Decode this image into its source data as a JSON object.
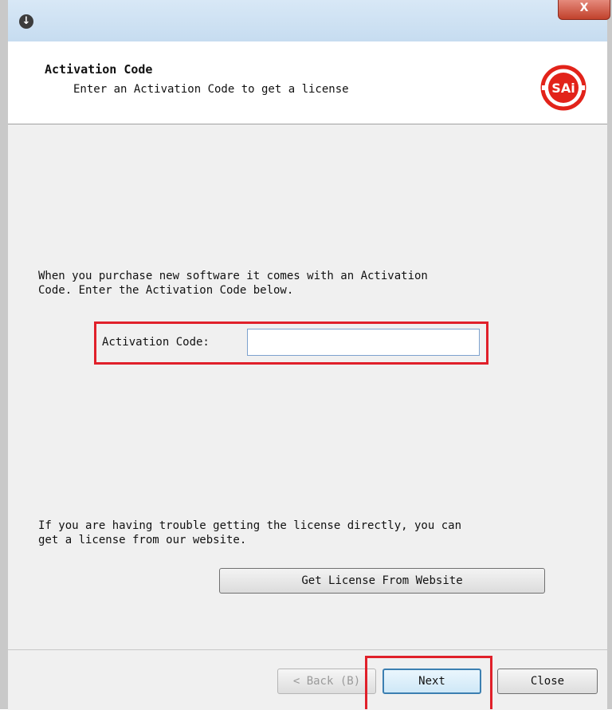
{
  "window": {
    "close_label": "X"
  },
  "header": {
    "title": "Activation Code",
    "subtitle": "Enter an Activation Code to get a license",
    "logo_text": "SAi",
    "logo_color": "#e2231a"
  },
  "main": {
    "intro_text": "When you purchase new software it comes with an Activation\nCode.  Enter the Activation Code below.",
    "activation_code_label": "Activation Code:",
    "activation_code_value": "",
    "trouble_text": "If you are having trouble getting the license directly, you can\nget a license from our website.",
    "website_button_label": "Get License From Website",
    "highlight_color": "#e0202a"
  },
  "footer": {
    "back_label": "< Back (B)",
    "next_label": "Next",
    "close_label": "Close"
  }
}
